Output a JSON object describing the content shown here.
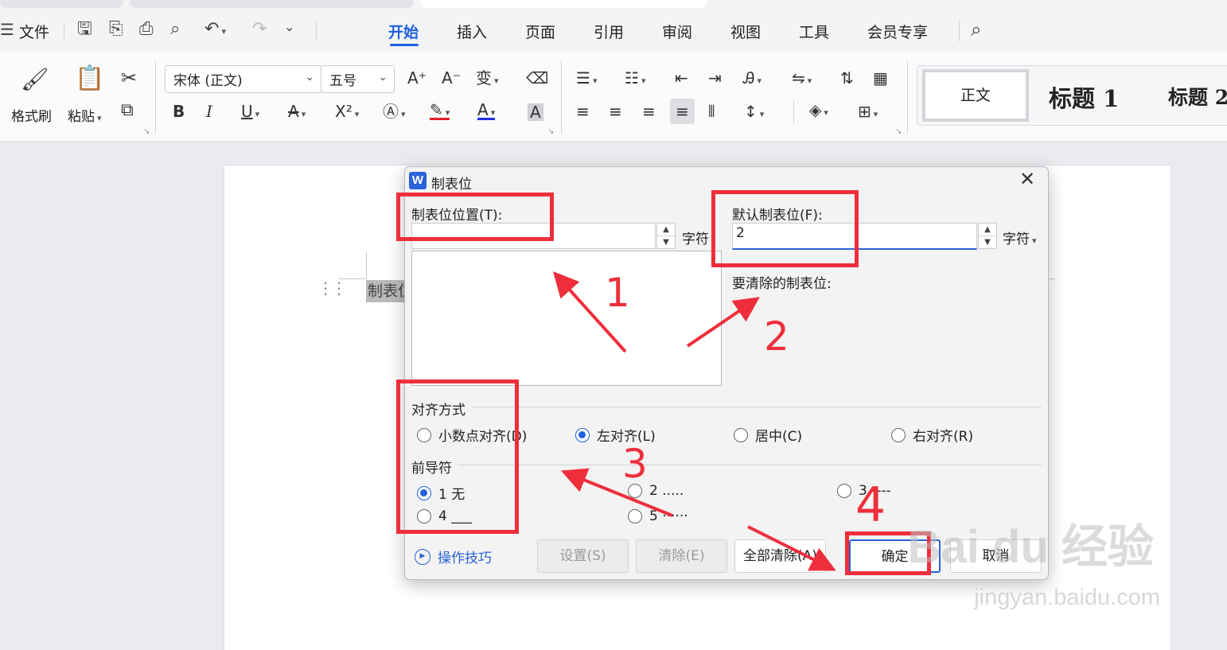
{
  "menubar": {
    "file_label": "文件",
    "tabs": [
      {
        "label": "开始"
      },
      {
        "label": "插入"
      },
      {
        "label": "页面"
      },
      {
        "label": "引用"
      },
      {
        "label": "审阅"
      },
      {
        "label": "视图"
      },
      {
        "label": "工具"
      },
      {
        "label": "会员专享"
      }
    ]
  },
  "ribbon": {
    "format_painter": "格式刷",
    "paste": "粘贴",
    "font_name": "宋体 (正文)",
    "font_size": "五号",
    "bold": "B",
    "italic": "I",
    "underline": "U",
    "strikethrough": "A",
    "superscript": "X²",
    "styles": {
      "normal": "正文",
      "heading1": "标题  1",
      "heading2": "标题  2"
    }
  },
  "document": {
    "selected_text": "制表位"
  },
  "dialog": {
    "title": "制表位",
    "tab_position_label": "制表位位置(T):",
    "tab_position_value": "",
    "unit": "字符",
    "default_tab_label": "默认制表位(F):",
    "default_tab_value": "2",
    "clear_label": "要清除的制表位:",
    "alignment_label": "对齐方式",
    "alignment_options": [
      {
        "label": "小数点对齐(D)",
        "selected": false
      },
      {
        "label": "左对齐(L)",
        "selected": true
      },
      {
        "label": "居中(C)",
        "selected": false
      },
      {
        "label": "右对齐(R)",
        "selected": false
      }
    ],
    "leader_label": "前导符",
    "leader_options": [
      {
        "label": "1 无",
        "selected": true
      },
      {
        "label": "2 .....",
        "selected": false
      },
      {
        "label": "3 ----",
        "selected": false
      },
      {
        "label": "4 ___",
        "selected": false
      },
      {
        "label": "5 ······",
        "selected": false
      }
    ],
    "tips": "操作技巧",
    "buttons": {
      "set": "设置(S)",
      "clear": "清除(E)",
      "clear_all": "全部清除(A)",
      "ok": "确定",
      "cancel": "取消"
    }
  },
  "annotations": {
    "numbers": [
      "1",
      "2",
      "3",
      "4"
    ],
    "color": "#ee2f3b"
  },
  "watermark": {
    "brand": "Bai du 经验",
    "url": "jingyan.baidu.com"
  },
  "colors": {
    "accent": "#1f5fe0",
    "annotation_red": "#ee2f3b"
  }
}
